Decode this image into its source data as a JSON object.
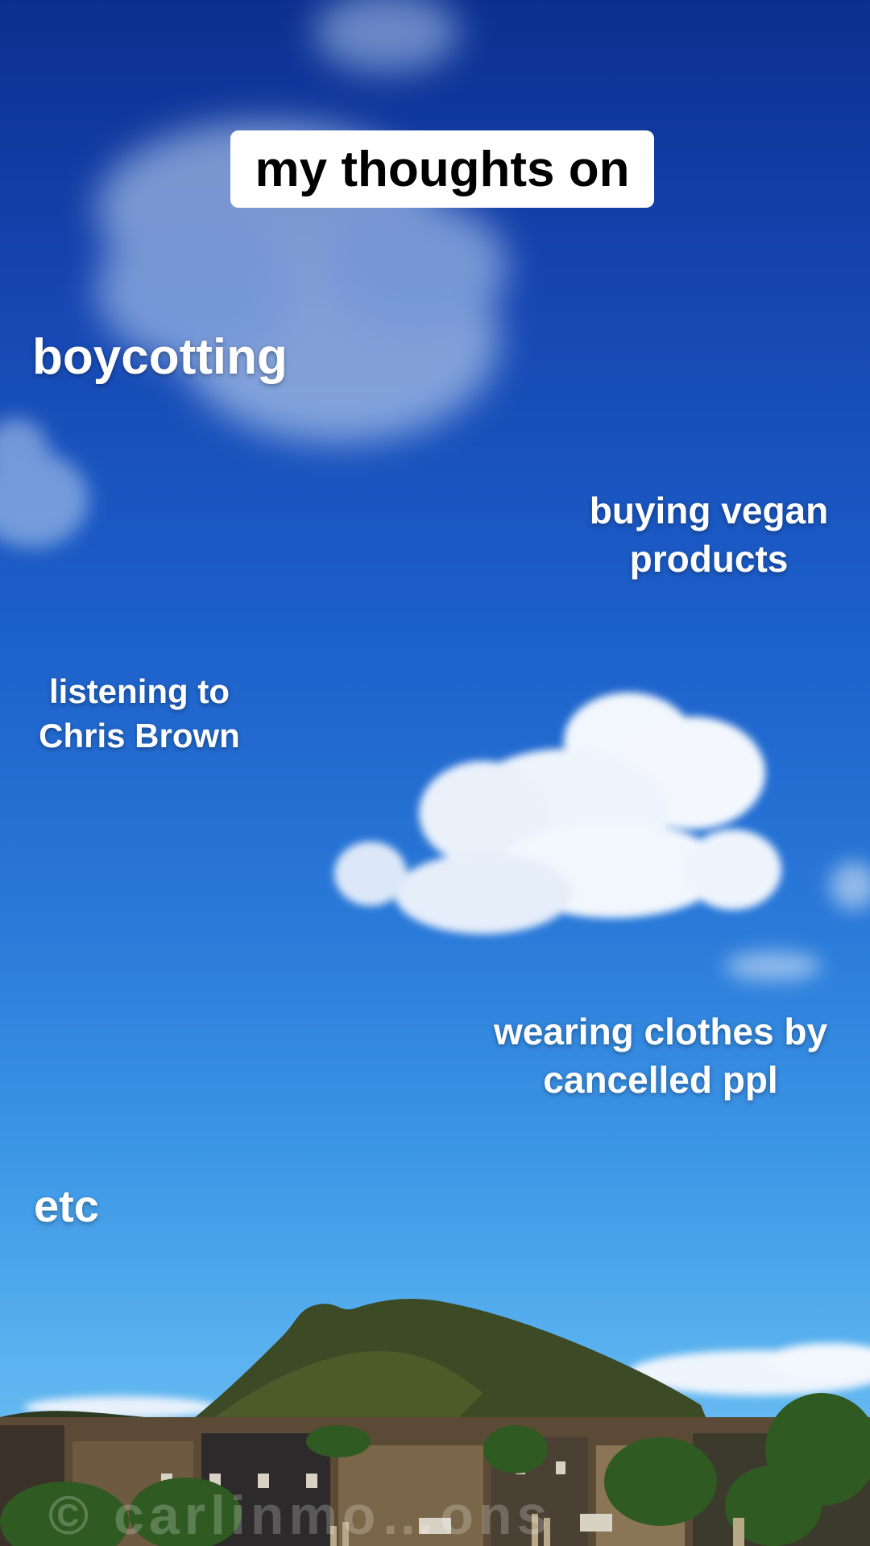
{
  "story": {
    "title": "my thoughts on",
    "items": [
      "boycotting",
      "buying vegan\nproducts",
      "listening to\nChris Brown",
      "wearing clothes by\ncancelled ppl",
      "etc"
    ]
  },
  "photo": {
    "subject": "blue-sky-with-clouds-over-hill-and-city",
    "watermark": "© carlinmo…ons"
  },
  "colors": {
    "sky_top": "#0b2f8f",
    "sky_bottom": "#7cc6f5",
    "title_bg": "#ffffff",
    "title_text": "#000000",
    "caption_text": "#ffffff"
  }
}
